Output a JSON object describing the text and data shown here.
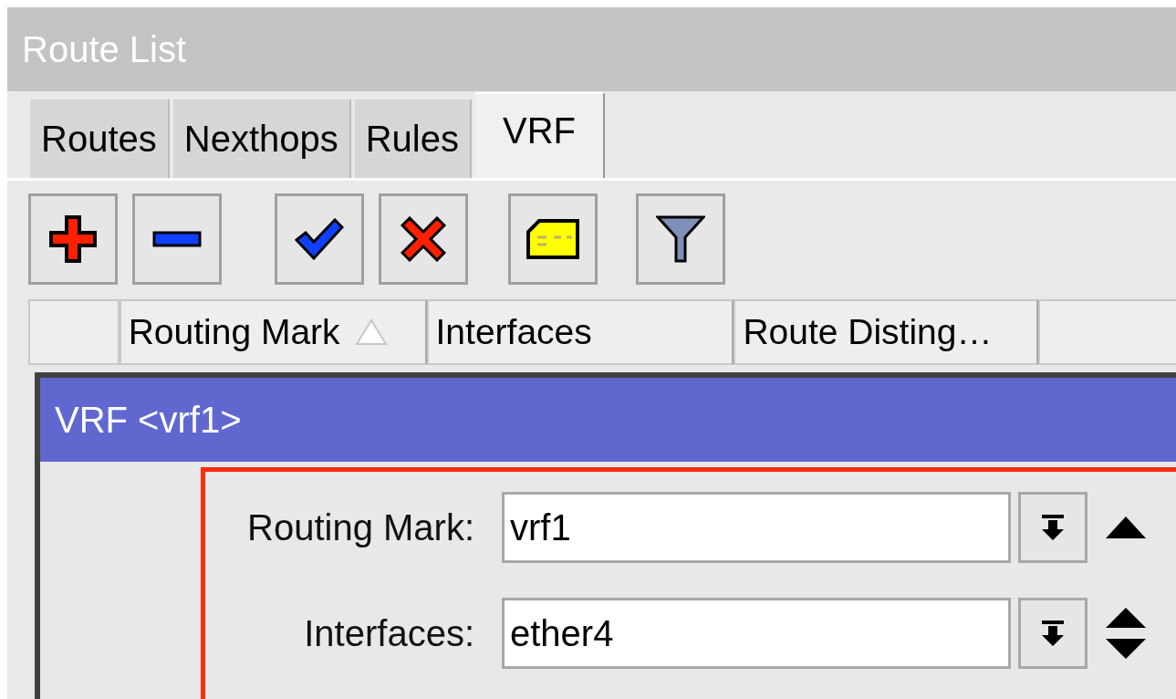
{
  "window": {
    "title": "Route List"
  },
  "tabs": [
    {
      "label": "Routes",
      "selected": false
    },
    {
      "label": "Nexthops",
      "selected": false
    },
    {
      "label": "Rules",
      "selected": false
    },
    {
      "label": "VRF",
      "selected": true
    }
  ],
  "toolbar": [
    {
      "kind": "add"
    },
    {
      "kind": "remove"
    },
    {
      "kind": "enable"
    },
    {
      "kind": "disable"
    },
    {
      "kind": "comment"
    },
    {
      "kind": "filter"
    }
  ],
  "table": {
    "columns": [
      {
        "label": "Routing Mark",
        "sorted": true
      },
      {
        "label": "Interfaces",
        "sorted": false
      },
      {
        "label": "Route Disting…",
        "sorted": false
      }
    ]
  },
  "dialog": {
    "title": "VRF <vrf1>",
    "fields": [
      {
        "label": "Routing Mark:",
        "value": "vrf1",
        "kind": "up"
      },
      {
        "label": "Interfaces:",
        "value": "ether4",
        "kind": "up_down"
      }
    ]
  }
}
